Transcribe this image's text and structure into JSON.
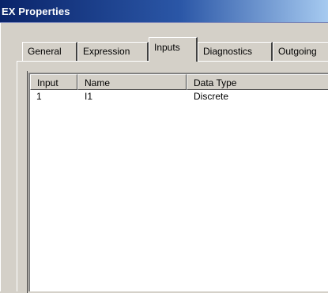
{
  "window": {
    "title": "EX Properties"
  },
  "tabs": [
    {
      "label": "General",
      "active": false
    },
    {
      "label": "Expression",
      "active": false
    },
    {
      "label": "Inputs",
      "active": true
    },
    {
      "label": "Diagnostics",
      "active": false
    },
    {
      "label": "Outgoing",
      "active": false
    }
  ],
  "table": {
    "columns": [
      "Input",
      "Name",
      "Data Type"
    ],
    "rows": [
      {
        "input": "1",
        "name": "I1",
        "data_type": "Discrete"
      }
    ]
  }
}
